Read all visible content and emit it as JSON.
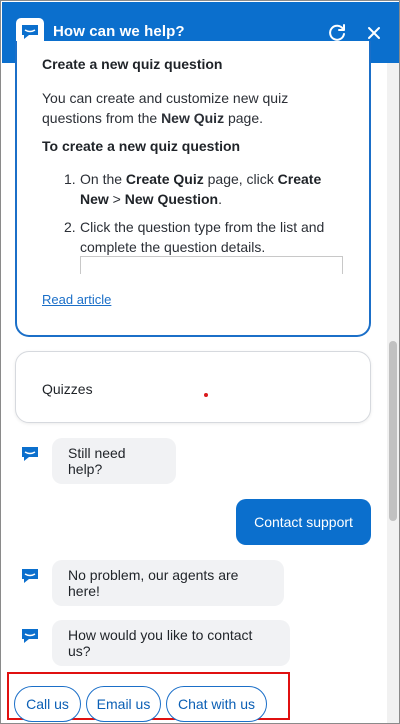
{
  "header": {
    "title": "How can we help?",
    "logo_icon": "chat-bubble-icon",
    "refresh_icon": "refresh-icon",
    "close_icon": "close-icon",
    "color": "#0b6fcd"
  },
  "article": {
    "heading": "Create a new quiz question",
    "para_pre": "You can create and customize new quiz questions from the ",
    "para_bold": "New Quiz",
    "para_post": " page.",
    "subheading": "To create a new quiz question",
    "steps": [
      {
        "num": "1.",
        "pre": "On the ",
        "b1": "Create Quiz",
        "mid": " page, click ",
        "b2": "Create New",
        "sep": " > ",
        "b3": "New Question",
        "post": "."
      },
      {
        "num": "2.",
        "text": "Click the question type from the list and complete the question details."
      }
    ],
    "read_link": "Read article"
  },
  "quiz_card": {
    "label": "Quizzes"
  },
  "messages": {
    "bot1": "Still need help?",
    "user1": "Contact support",
    "bot2": "No problem, our agents are here!",
    "bot3": "How would you like to contact us?"
  },
  "options": [
    "Call us",
    "Email us",
    "Chat with us"
  ],
  "colors": {
    "accent": "#0b6fcd",
    "highlight_box": "#e01010",
    "bubble_bg": "#f1f2f4"
  }
}
